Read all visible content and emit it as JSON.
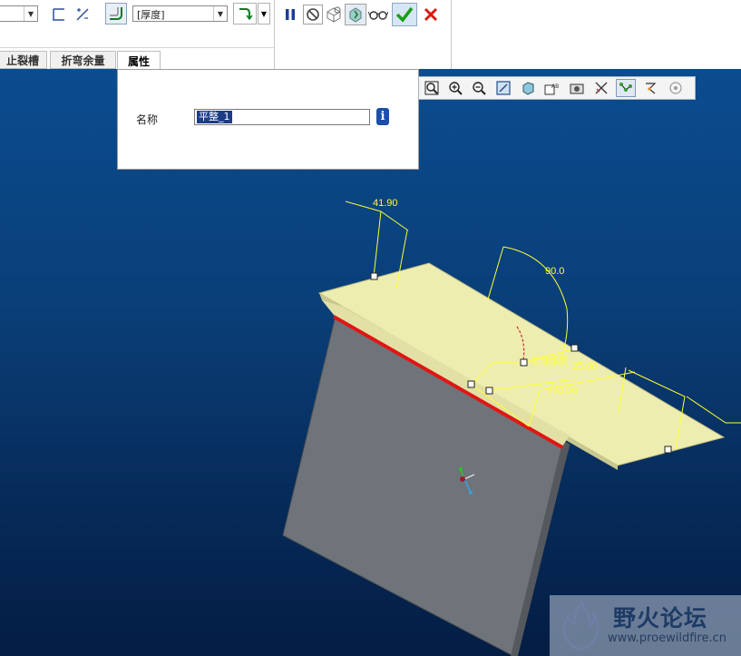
{
  "dashboard": {
    "combo_first": {
      "value": ""
    },
    "shape_icons": [
      "flat-edge-shape-icon",
      "flip-direction-icon"
    ],
    "bend_icon": "bend-radius-icon",
    "thickness_combo": {
      "value": "[厚度]"
    },
    "offset_icon": "bend-position-icon",
    "controls": [
      "pause-icon",
      "no-preview-icon",
      "preview-icon",
      "verify-icon",
      "glasses-icon",
      "ok-check-icon",
      "cancel-x-icon"
    ],
    "colors": {
      "ok": "#1a9e1a",
      "cancel": "#d81818",
      "pause": "#1d3c9c"
    }
  },
  "tabs": [
    {
      "label": "止裂槽",
      "active": false
    },
    {
      "label": "折弯余量",
      "active": false
    },
    {
      "label": "属性",
      "active": true
    }
  ],
  "properties_panel": {
    "name_label": "名称",
    "name_value": "平整_1",
    "info_icon": "i"
  },
  "view_toolbar": {
    "icons": [
      "zoom-window-icon",
      "zoom-in-icon",
      "zoom-out-icon",
      "refit-icon",
      "shading-icon",
      "view-manager-icon",
      "saved-views-icon",
      "datum-display-icon",
      "axis-display-icon",
      "point-display-icon",
      "csys-display-icon",
      "spin-center-icon"
    ]
  },
  "model_dims": {
    "d1": "41.90",
    "d2": "90.0",
    "d3": "25.00",
    "d4": "270.00",
    "d5": "加厚厚度"
  },
  "watermark": {
    "title": "野火论坛",
    "url": "www.proewildfire.cn"
  }
}
